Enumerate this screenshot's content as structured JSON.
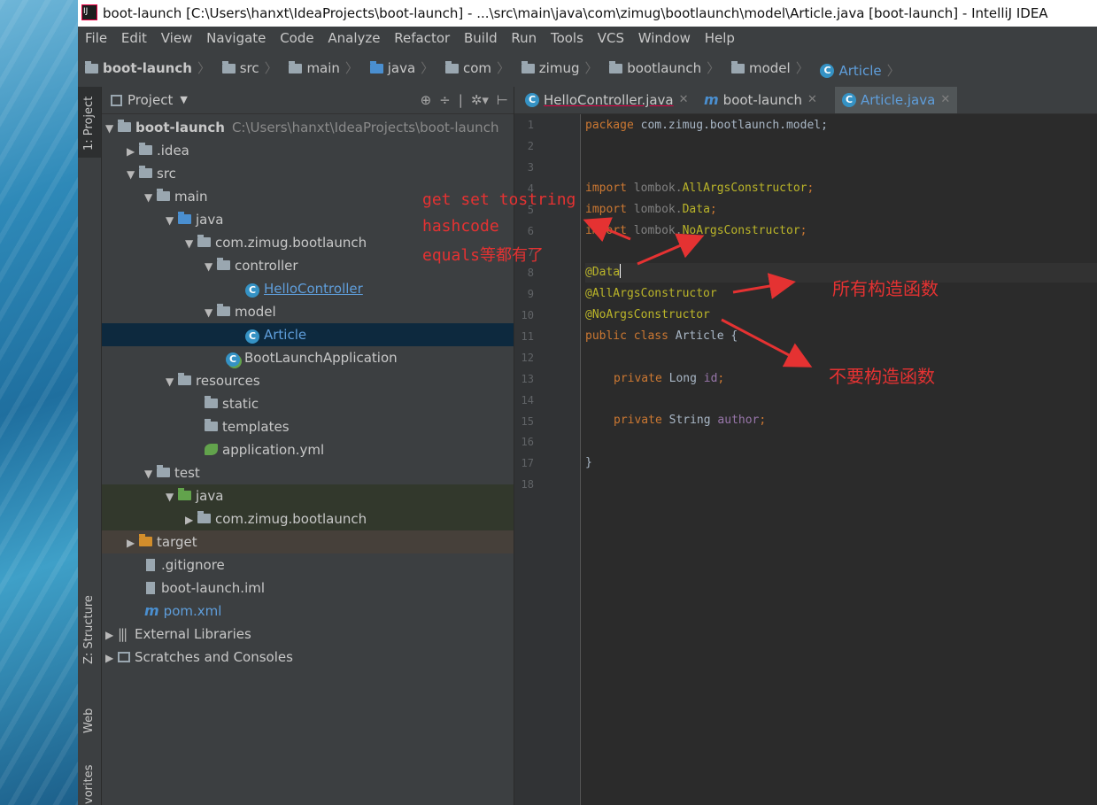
{
  "window": {
    "title": "boot-launch [C:\\Users\\hanxt\\IdeaProjects\\boot-launch] - ...\\src\\main\\java\\com\\zimug\\bootlaunch\\model\\Article.java [boot-launch] - IntelliJ IDEA"
  },
  "menu": [
    "File",
    "Edit",
    "View",
    "Navigate",
    "Code",
    "Analyze",
    "Refactor",
    "Build",
    "Run",
    "Tools",
    "VCS",
    "Window",
    "Help"
  ],
  "breadcrumbs": [
    "boot-launch",
    "src",
    "main",
    "java",
    "com",
    "zimug",
    "bootlaunch",
    "model",
    "Article"
  ],
  "side_tabs": {
    "project": "1: Project",
    "structure": "Z: Structure",
    "web": "Web",
    "favorites": "vorites"
  },
  "project_panel": {
    "title": "Project",
    "tree": [
      {
        "label": "boot-launch",
        "path": "C:\\Users\\hanxt\\IdeaProjects\\boot-launch"
      },
      {
        "label": ".idea"
      },
      {
        "label": "src"
      },
      {
        "label": "main"
      },
      {
        "label": "java"
      },
      {
        "label": "com.zimug.bootlaunch"
      },
      {
        "label": "controller"
      },
      {
        "label": "HelloController"
      },
      {
        "label": "model"
      },
      {
        "label": "Article"
      },
      {
        "label": "BootLaunchApplication"
      },
      {
        "label": "resources"
      },
      {
        "label": "static"
      },
      {
        "label": "templates"
      },
      {
        "label": "application.yml"
      },
      {
        "label": "test"
      },
      {
        "label": "java"
      },
      {
        "label": "com.zimug.bootlaunch"
      },
      {
        "label": "target"
      },
      {
        "label": ".gitignore"
      },
      {
        "label": "boot-launch.iml"
      },
      {
        "label": "pom.xml"
      },
      {
        "label": "External Libraries"
      },
      {
        "label": "Scratches and Consoles"
      }
    ]
  },
  "editor_tabs": [
    {
      "label": "HelloController.java"
    },
    {
      "label": "boot-launch"
    },
    {
      "label": "Article.java"
    }
  ],
  "code": {
    "line_numbers": [
      "1",
      "2",
      "3",
      "4",
      "5",
      "6",
      "7",
      "8",
      "9",
      "10",
      "11",
      "12",
      "13",
      "14",
      "15",
      "16",
      "17",
      "18"
    ],
    "l1_kw": "package ",
    "l1_rest": "com.zimug.bootlaunch.model;",
    "l4_kw": "import ",
    "l4_pkg": "lombok.",
    "l4_cls": "AllArgsConstructor",
    "l4_end": ";",
    "l5_kw": "import ",
    "l5_pkg": "lombok.",
    "l5_cls": "Data",
    "l5_end": ";",
    "l6_kw": "import ",
    "l6_pkg": "lombok.",
    "l6_cls": "NoArgsConstructor",
    "l6_end": ";",
    "l8": "@Data",
    "l9": "@AllArgsConstructor",
    "l10": "@NoArgsConstructor",
    "l11_kw": "public class ",
    "l11_rest": "Article {",
    "l13_kw": "private ",
    "l13_type": "Long ",
    "l13_field": "id",
    "l13_end": ";",
    "l15_kw": "private ",
    "l15_type": "String ",
    "l15_field": "author",
    "l15_end": ";",
    "l17": "}"
  },
  "annotations": {
    "note1_line1": "get  set  tostring",
    "note1_line2": "hashcode",
    "note1_line3": "equals等都有了",
    "note2": "所有构造函数",
    "note3": "不要构造函数"
  },
  "colors": {
    "annotation_red": "#e53232",
    "keyword": "#cc7832",
    "annotation": "#bbb529",
    "link": "#5f9edb"
  }
}
